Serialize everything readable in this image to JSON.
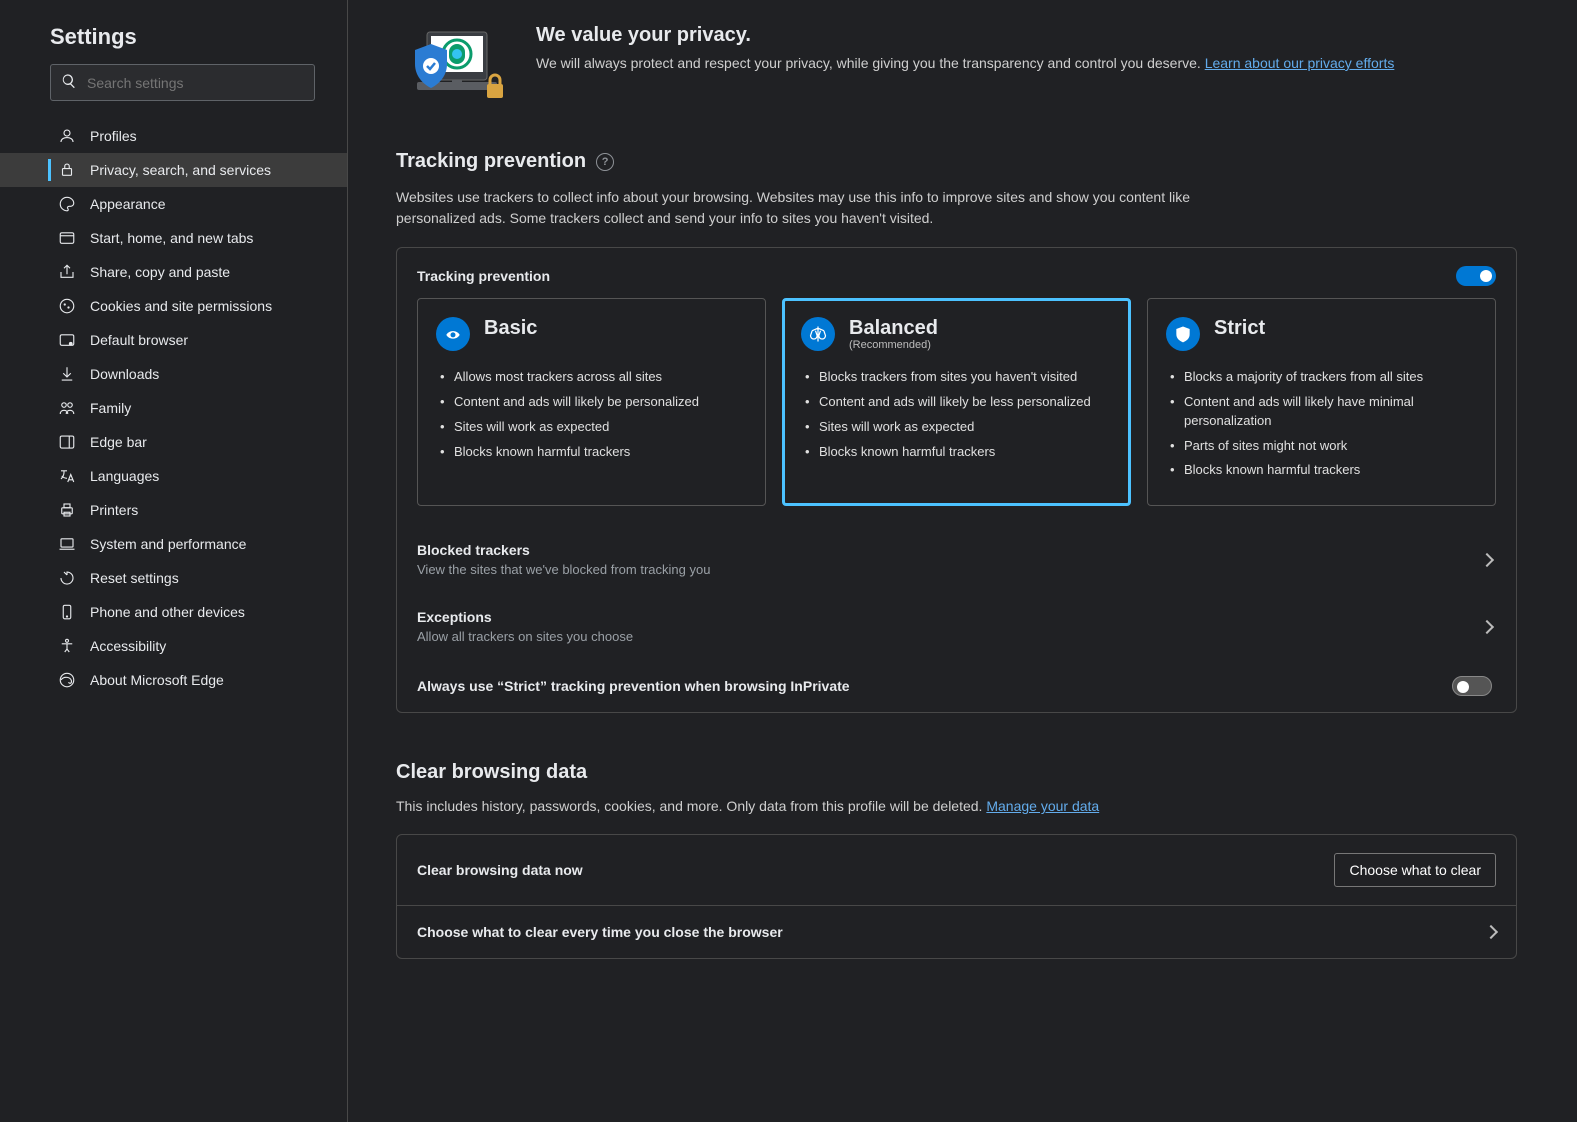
{
  "sidebar": {
    "title": "Settings",
    "search_placeholder": "Search settings",
    "items": [
      {
        "label": "Profiles"
      },
      {
        "label": "Privacy, search, and services"
      },
      {
        "label": "Appearance"
      },
      {
        "label": "Start, home, and new tabs"
      },
      {
        "label": "Share, copy and paste"
      },
      {
        "label": "Cookies and site permissions"
      },
      {
        "label": "Default browser"
      },
      {
        "label": "Downloads"
      },
      {
        "label": "Family"
      },
      {
        "label": "Edge bar"
      },
      {
        "label": "Languages"
      },
      {
        "label": "Printers"
      },
      {
        "label": "System and performance"
      },
      {
        "label": "Reset settings"
      },
      {
        "label": "Phone and other devices"
      },
      {
        "label": "Accessibility"
      },
      {
        "label": "About Microsoft Edge"
      }
    ]
  },
  "hero": {
    "title": "We value your privacy.",
    "desc": "We will always protect and respect your privacy, while giving you the transparency and control you deserve. ",
    "link": "Learn about our privacy efforts"
  },
  "tracking": {
    "title": "Tracking prevention",
    "desc": "Websites use trackers to collect info about your browsing. Websites may use this info to improve sites and show you content like personalized ads. Some trackers collect and send your info to sites you haven't visited.",
    "card_title": "Tracking prevention",
    "options": [
      {
        "title": "Basic",
        "sub": "",
        "bullets": [
          "Allows most trackers across all sites",
          "Content and ads will likely be personalized",
          "Sites will work as expected",
          "Blocks known harmful trackers"
        ]
      },
      {
        "title": "Balanced",
        "sub": "(Recommended)",
        "bullets": [
          "Blocks trackers from sites you haven't visited",
          "Content and ads will likely be less personalized",
          "Sites will work as expected",
          "Blocks known harmful trackers"
        ]
      },
      {
        "title": "Strict",
        "sub": "",
        "bullets": [
          "Blocks a majority of trackers from all sites",
          "Content and ads will likely have minimal personalization",
          "Parts of sites might not work",
          "Blocks known harmful trackers"
        ]
      }
    ],
    "blocked_title": "Blocked trackers",
    "blocked_sub": "View the sites that we've blocked from tracking you",
    "exceptions_title": "Exceptions",
    "exceptions_sub": "Allow all trackers on sites you choose",
    "strict_inprivate": "Always use “Strict” tracking prevention when browsing InPrivate"
  },
  "clear": {
    "title": "Clear browsing data",
    "desc": "This includes history, passwords, cookies, and more. Only data from this profile will be deleted. ",
    "link": "Manage your data",
    "row1_title": "Clear browsing data now",
    "row1_btn": "Choose what to clear",
    "row2_title": "Choose what to clear every time you close the browser"
  }
}
